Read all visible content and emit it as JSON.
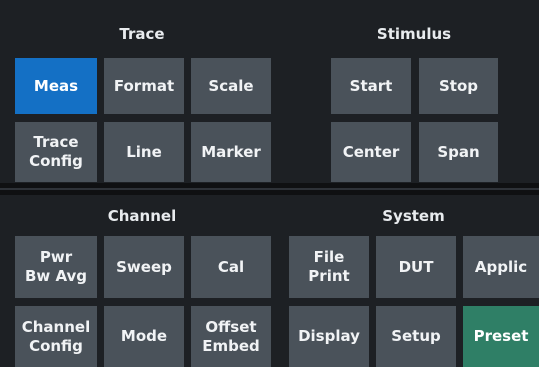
{
  "trace": {
    "title": "Trace",
    "meas": "Meas",
    "format": "Format",
    "scale": "Scale",
    "trace_config": "Trace\nConfig",
    "line": "Line",
    "marker": "Marker"
  },
  "stimulus": {
    "title": "Stimulus",
    "start": "Start",
    "stop": "Stop",
    "center": "Center",
    "span": "Span"
  },
  "channel": {
    "title": "Channel",
    "pwr_bw_avg": "Pwr\nBw Avg",
    "sweep": "Sweep",
    "cal": "Cal",
    "channel_config": "Channel\nConfig",
    "mode": "Mode",
    "offset_embed": "Offset\nEmbed"
  },
  "system": {
    "title": "System",
    "file_print": "File\nPrint",
    "dut": "DUT",
    "applic": "Applic",
    "display": "Display",
    "setup": "Setup",
    "preset": "Preset"
  },
  "colors": {
    "panel": "#1d2024",
    "button": "#4a525a",
    "active": "#1470c5",
    "preset": "#2f7f66"
  }
}
